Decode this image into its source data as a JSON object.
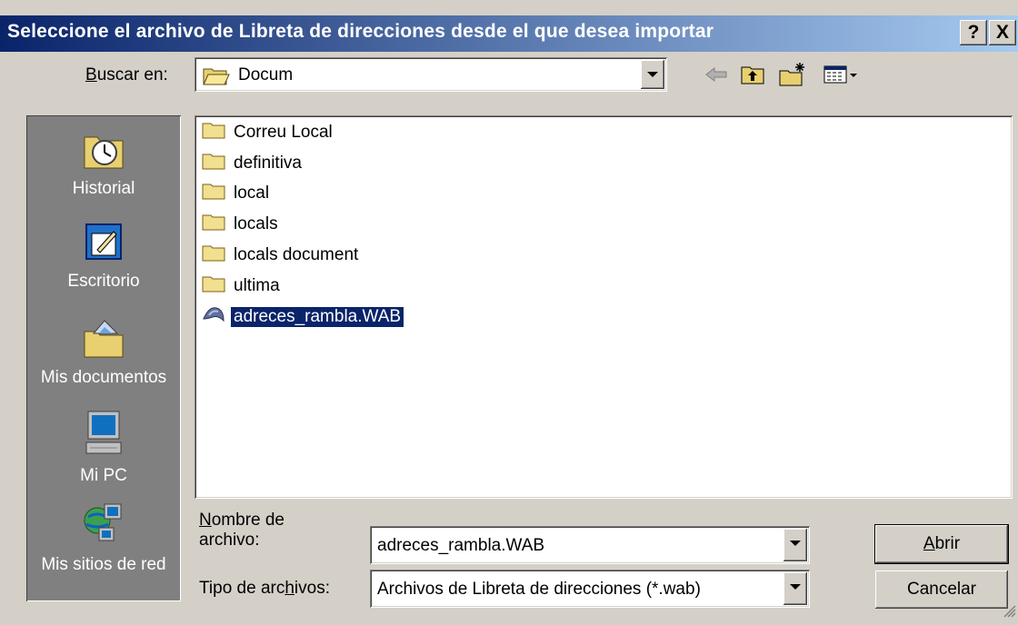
{
  "window": {
    "title": "Seleccione el archivo de Libreta de direcciones desde el que desea importar",
    "help_label": "?",
    "close_label": "X"
  },
  "lookin": {
    "label_accel": "B",
    "label_rest": "uscar en:",
    "value": "Docum"
  },
  "toolbar": {
    "back_icon": "back-arrow-icon",
    "up_icon": "up-folder-icon",
    "new_folder_icon": "new-folder-icon",
    "view_icon": "view-menu-icon"
  },
  "sidebar": {
    "items": [
      {
        "label": "Historial",
        "icon": "history-icon"
      },
      {
        "label": "Escritorio",
        "icon": "desktop-icon"
      },
      {
        "label": "Mis documentos",
        "icon": "my-documents-icon"
      },
      {
        "label": "Mi PC",
        "icon": "my-computer-icon"
      },
      {
        "label": "Mis sitios de red",
        "icon": "network-places-icon"
      }
    ]
  },
  "files": [
    {
      "name": "Correu Local",
      "type": "folder"
    },
    {
      "name": "definitiva",
      "type": "folder"
    },
    {
      "name": "local",
      "type": "folder"
    },
    {
      "name": "locals",
      "type": "folder"
    },
    {
      "name": "locals document",
      "type": "folder"
    },
    {
      "name": "ultima",
      "type": "folder"
    },
    {
      "name": "adreces_rambla.WAB",
      "type": "wab",
      "selected": true
    }
  ],
  "filename": {
    "label_line1_accel": "N",
    "label_line1_rest": "ombre de",
    "label_line2": "archivo:",
    "value": "adreces_rambla.WAB"
  },
  "filetype": {
    "label_pre": "Tipo de arc",
    "label_accel": "h",
    "label_post": "ivos:",
    "value": "Archivos de Libreta de direcciones (*.wab)"
  },
  "buttons": {
    "open_accel": "A",
    "open_rest": "brir",
    "cancel": "Cancelar"
  },
  "colors": {
    "titlebar_start": "#0a246a",
    "titlebar_end": "#a6caf0",
    "selection": "#0a246a",
    "face": "#d4d0c8"
  }
}
